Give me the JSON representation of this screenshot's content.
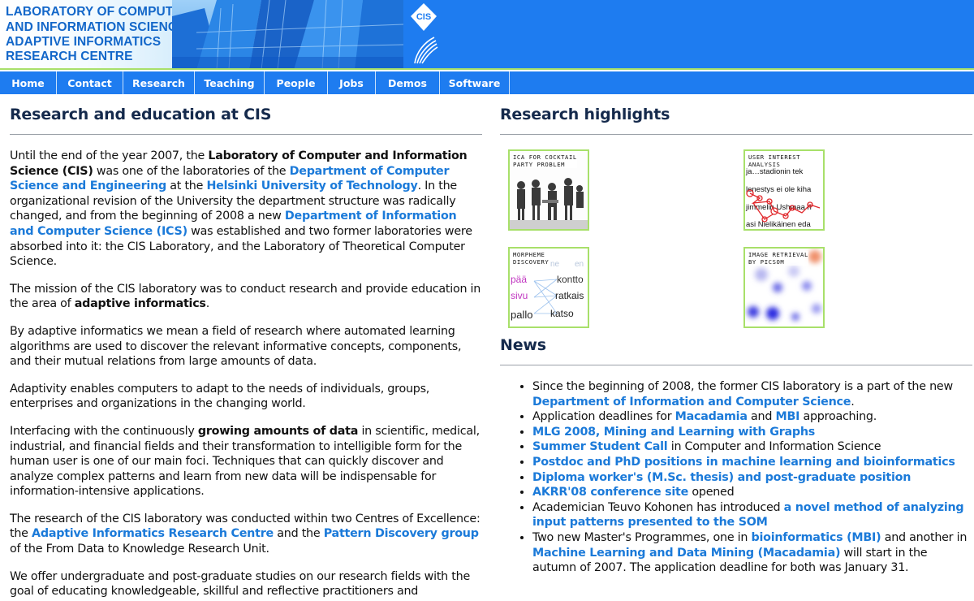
{
  "header": {
    "logo_lines": [
      "LABORATORY OF COMPUTER",
      "AND INFORMATION SCIENCE",
      "ADAPTIVE INFORMATICS",
      "RESEARCH CENTRE"
    ],
    "emblem_text": "CIS"
  },
  "nav": {
    "items": [
      "Home",
      "Contact",
      "Research",
      "Teaching",
      "People",
      "Jobs",
      "Demos",
      "Software"
    ]
  },
  "left": {
    "title": "Research and education at CIS",
    "p1": {
      "t1": "Until the end of the year 2007, the ",
      "b1": "Laboratory of Computer and Information Science (CIS)",
      "t2": " was one of the laboratories of the ",
      "l1": "Department of Computer Science and Engineering",
      "t3": " at the ",
      "l2": "Helsinki University of Technology",
      "t4": ". In the organizational revision of the University the department structure was radically changed, and from the beginning of 2008 a new ",
      "l3": "Department of Information and Computer Science (ICS)",
      "t5": " was established and two former laboratories were absorbed into it: the CIS Laboratory, and the Laboratory of Theoretical Computer Science."
    },
    "p2": {
      "t1": "The mission of the CIS laboratory was to conduct research and provide education in the area of ",
      "b1": "adaptive informatics",
      "t2": "."
    },
    "p3": "By adaptive informatics we mean a field of research where automated learning algorithms are used to discover the relevant informative concepts, components, and their mutual relations from large amounts of data.",
    "p4": "Adaptivity enables computers to adapt to the needs of individuals, groups, enterprises and organizations in the changing world.",
    "p5": {
      "t1": "Interfacing with the continuously ",
      "b1": "growing amounts of data",
      "t2": " in scientific, medical, industrial, and financial fields and their transformation to intelligible form for the human user is one of our main foci. Techniques that can quickly discover and analyze complex patterns and learn from new data will be indispensable for information-intensive applications."
    },
    "p6": {
      "t1": "The research of the CIS laboratory was conducted within two Centres of Excellence: the ",
      "l1": "Adaptive Informatics Research Centre",
      "t2": " and the ",
      "l2": "Pattern Discovery group",
      "t3": " of the From Data to Knowledge Research Unit."
    },
    "p7": "We offer undergraduate and post-graduate studies on our research fields with the goal of educating knowledgeable, skillful and reflective practitioners and"
  },
  "right": {
    "highlights_title": "Research highlights",
    "highlights": [
      {
        "caption": "ICA FOR COCKTAIL\nPARTY PROBLEM"
      },
      {
        "caption": "USER INTEREST\nANALYSIS",
        "words": [
          "ja…stadionin tek",
          "lenestys ei ole kiha",
          "jimmelin Ushmaa h",
          "asi Nielikäinen eda"
        ]
      },
      {
        "caption": "MORPHEME\nDISCOVERY",
        "words": [
          "ne",
          "en",
          "pää",
          "kontto",
          "sivu",
          "ratkais",
          "pallo",
          "katso"
        ]
      },
      {
        "caption": "IMAGE RETRIEVAL\nBY PICSOM"
      }
    ],
    "news_title": "News",
    "news": [
      {
        "t1": "Since the beginning of 2008, the former CIS laboratory is a part of the new ",
        "l1": "Department of Information and Computer Science",
        "t2": "."
      },
      {
        "t1": "Application deadlines for ",
        "l1": "Macadamia",
        "t2": " and ",
        "l2": "MBI",
        "t3": " approaching."
      },
      {
        "l1": "MLG 2008, Mining and Learning with Graphs"
      },
      {
        "l1": "Summer Student Call",
        "t1": " in Computer and Information Science"
      },
      {
        "l1": "Postdoc and PhD positions in machine learning and bioinformatics"
      },
      {
        "l1": "Diploma worker's (M.Sc. thesis) and post-graduate position"
      },
      {
        "l1": "AKRR'08 conference site",
        "t1": " opened"
      },
      {
        "t1": "Academician Teuvo Kohonen has introduced ",
        "l1": "a novel method of analyzing input patterns presented to the SOM"
      },
      {
        "t1": "Two new Master's Programmes, one in ",
        "l1": "bioinformatics (MBI)",
        "t2": " and another in ",
        "l2": "Machine Learning and Data Mining (Macadamia)",
        "t3": " will start in the autumn of 2007. The application deadline for both was January 31."
      }
    ]
  },
  "colors": {
    "header_blue": "#1e7cf0",
    "green_accent": "#a8e06a",
    "link_blue": "#1b7ad9",
    "heading_navy": "#152a4c"
  }
}
